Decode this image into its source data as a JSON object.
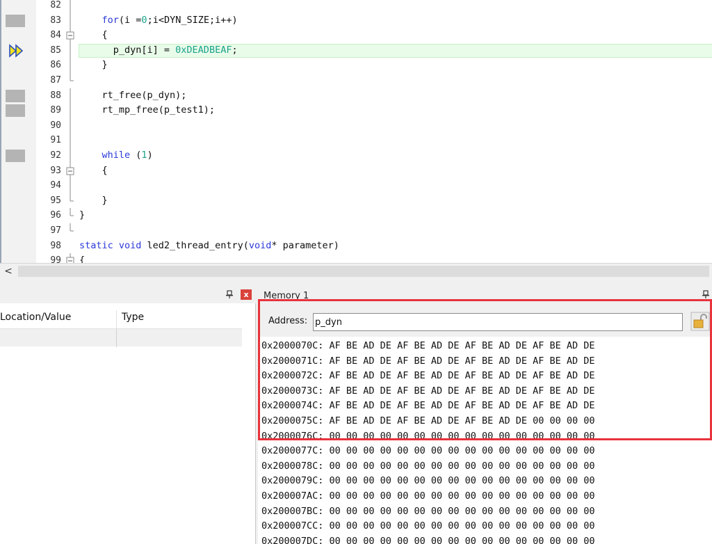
{
  "editor": {
    "lines": [
      {
        "num": "82",
        "code": "",
        "fold": "line",
        "marker": "",
        "current": false
      },
      {
        "num": "83",
        "code": "    <k>for</k>(i =<n>0</n>;i<DYN_SIZE;i++)",
        "fold": "line",
        "marker": "bp",
        "current": false
      },
      {
        "num": "84",
        "code": "    {",
        "fold": "box",
        "marker": "",
        "current": false
      },
      {
        "num": "85",
        "code": "      p_dyn[i] = <n>0xDEADBEAF</n>;",
        "fold": "line",
        "marker": "arrow",
        "current": true
      },
      {
        "num": "86",
        "code": "    }",
        "fold": "line",
        "marker": "",
        "current": false
      },
      {
        "num": "87",
        "code": "",
        "fold": "end",
        "marker": "",
        "current": false
      },
      {
        "num": "88",
        "code": "    rt_free(p_dyn);",
        "fold": "line",
        "marker": "bp",
        "current": false
      },
      {
        "num": "89",
        "code": "    rt_mp_free(p_test1);",
        "fold": "line",
        "marker": "bp",
        "current": false
      },
      {
        "num": "90",
        "code": "",
        "fold": "line",
        "marker": "",
        "current": false
      },
      {
        "num": "91",
        "code": "",
        "fold": "line",
        "marker": "",
        "current": false
      },
      {
        "num": "92",
        "code": "    <k>while</k> (<n>1</n>)",
        "fold": "line",
        "marker": "bp",
        "current": false
      },
      {
        "num": "93",
        "code": "    {",
        "fold": "box",
        "marker": "",
        "current": false
      },
      {
        "num": "94",
        "code": "",
        "fold": "line",
        "marker": "",
        "current": false
      },
      {
        "num": "95",
        "code": "    }",
        "fold": "end",
        "marker": "",
        "current": false
      },
      {
        "num": "96",
        "code": "}",
        "fold": "end",
        "marker": "",
        "current": false
      },
      {
        "num": "97",
        "code": "",
        "fold": "end",
        "marker": "",
        "current": false
      },
      {
        "num": "98",
        "code": "<k>static void</k> led2_thread_entry(<k>void</k>* parameter)",
        "fold": "none",
        "marker": "",
        "current": false
      },
      {
        "num": "99",
        "code": "{",
        "fold": "box",
        "marker": "",
        "current": false
      }
    ],
    "scroll_left_label": "<"
  },
  "watch": {
    "pin_label": "❐",
    "close_label": "x",
    "columns": [
      "Location/Value",
      "Type"
    ]
  },
  "memory": {
    "title": "Memory 1",
    "address_label": "Address:",
    "address_value": "p_dyn",
    "rows": [
      {
        "addr": "0x2000070C:",
        "bytes": "AF BE AD DE AF BE AD DE AF BE AD DE AF BE AD DE"
      },
      {
        "addr": "0x2000071C:",
        "bytes": "AF BE AD DE AF BE AD DE AF BE AD DE AF BE AD DE"
      },
      {
        "addr": "0x2000072C:",
        "bytes": "AF BE AD DE AF BE AD DE AF BE AD DE AF BE AD DE"
      },
      {
        "addr": "0x2000073C:",
        "bytes": "AF BE AD DE AF BE AD DE AF BE AD DE AF BE AD DE"
      },
      {
        "addr": "0x2000074C:",
        "bytes": "AF BE AD DE AF BE AD DE AF BE AD DE AF BE AD DE"
      },
      {
        "addr": "0x2000075C:",
        "bytes": "AF BE AD DE AF BE AD DE AF BE AD DE 00 00 00 00"
      },
      {
        "addr": "0x2000076C:",
        "bytes": "00 00 00 00 00 00 00 00 00 00 00 00 00 00 00 00"
      },
      {
        "addr": "0x2000077C:",
        "bytes": "00 00 00 00 00 00 00 00 00 00 00 00 00 00 00 00"
      },
      {
        "addr": "0x2000078C:",
        "bytes": "00 00 00 00 00 00 00 00 00 00 00 00 00 00 00 00"
      },
      {
        "addr": "0x2000079C:",
        "bytes": "00 00 00 00 00 00 00 00 00 00 00 00 00 00 00 00"
      },
      {
        "addr": "0x200007AC:",
        "bytes": "00 00 00 00 00 00 00 00 00 00 00 00 00 00 00 00"
      },
      {
        "addr": "0x200007BC:",
        "bytes": "00 00 00 00 00 00 00 00 00 00 00 00 00 00 00 00"
      },
      {
        "addr": "0x200007CC:",
        "bytes": "00 00 00 00 00 00 00 00 00 00 00 00 00 00 00 00"
      },
      {
        "addr": "0x200007DC:",
        "bytes": "00 00 00 00 00 00 00 00 00 00 00 00 00 00 00 00"
      }
    ]
  },
  "colors": {
    "highlight_box": "#e8323c",
    "current_line": "#e9fbe9",
    "keyword": "#2a39d8",
    "number": "#1aa38a"
  }
}
